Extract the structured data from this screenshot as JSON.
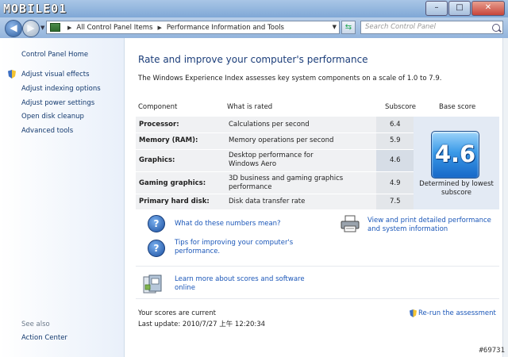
{
  "window": {
    "watermark_logo": "MOBILE01",
    "watermark_id": "#69731",
    "controls": {
      "minimize": "–",
      "maximize": "□",
      "close": "✕"
    }
  },
  "navbar": {
    "breadcrumbs": [
      "All Control Panel Items",
      "Performance Information and Tools"
    ],
    "search_placeholder": "Search Control Panel",
    "icons": [
      "back-arrow-icon",
      "forward-arrow-icon",
      "control-panel-icon",
      "refresh-icon",
      "search-icon"
    ]
  },
  "sidebar": {
    "home": "Control Panel Home",
    "items": [
      {
        "label": "Adjust visual effects",
        "icon": "uac-shield-icon"
      },
      {
        "label": "Adjust indexing options"
      },
      {
        "label": "Adjust power settings"
      },
      {
        "label": "Open disk cleanup"
      },
      {
        "label": "Advanced tools"
      }
    ],
    "see_also": "See also",
    "action_center": "Action Center"
  },
  "main": {
    "title": "Rate and improve your computer's performance",
    "description": "The Windows Experience Index assesses key system components on a scale of 1.0 to 7.9.",
    "table": {
      "headers": {
        "component": "Component",
        "what": "What is rated",
        "subscore": "Subscore",
        "base": "Base score"
      },
      "rows": [
        {
          "component": "Processor:",
          "what": "Calculations per second",
          "subscore": "6.4"
        },
        {
          "component": "Memory (RAM):",
          "what": "Memory operations per second",
          "subscore": "5.9"
        },
        {
          "component": "Graphics:",
          "what": "Desktop performance for Windows Aero",
          "subscore": "4.6"
        },
        {
          "component": "Gaming graphics:",
          "what": "3D business and gaming graphics performance",
          "subscore": "4.9"
        },
        {
          "component": "Primary hard disk:",
          "what": "Disk data transfer rate",
          "subscore": "7.5"
        }
      ]
    },
    "base_score": "4.6",
    "base_caption": "Determined by lowest subscore",
    "links": {
      "what_numbers": "What do these numbers mean?",
      "tips": "Tips for improving your computer's performance.",
      "print": "View and print detailed performance and system information",
      "learn_more": "Learn more about scores and software online"
    },
    "status": "Your scores are current",
    "last_update": "Last update: 2010/7/27 上午 12:20:34",
    "rerun": "Re-run the assessment",
    "colors": {
      "link": "#1a56b8",
      "title": "#1b3d79",
      "badge": "#3b9ae8"
    }
  }
}
